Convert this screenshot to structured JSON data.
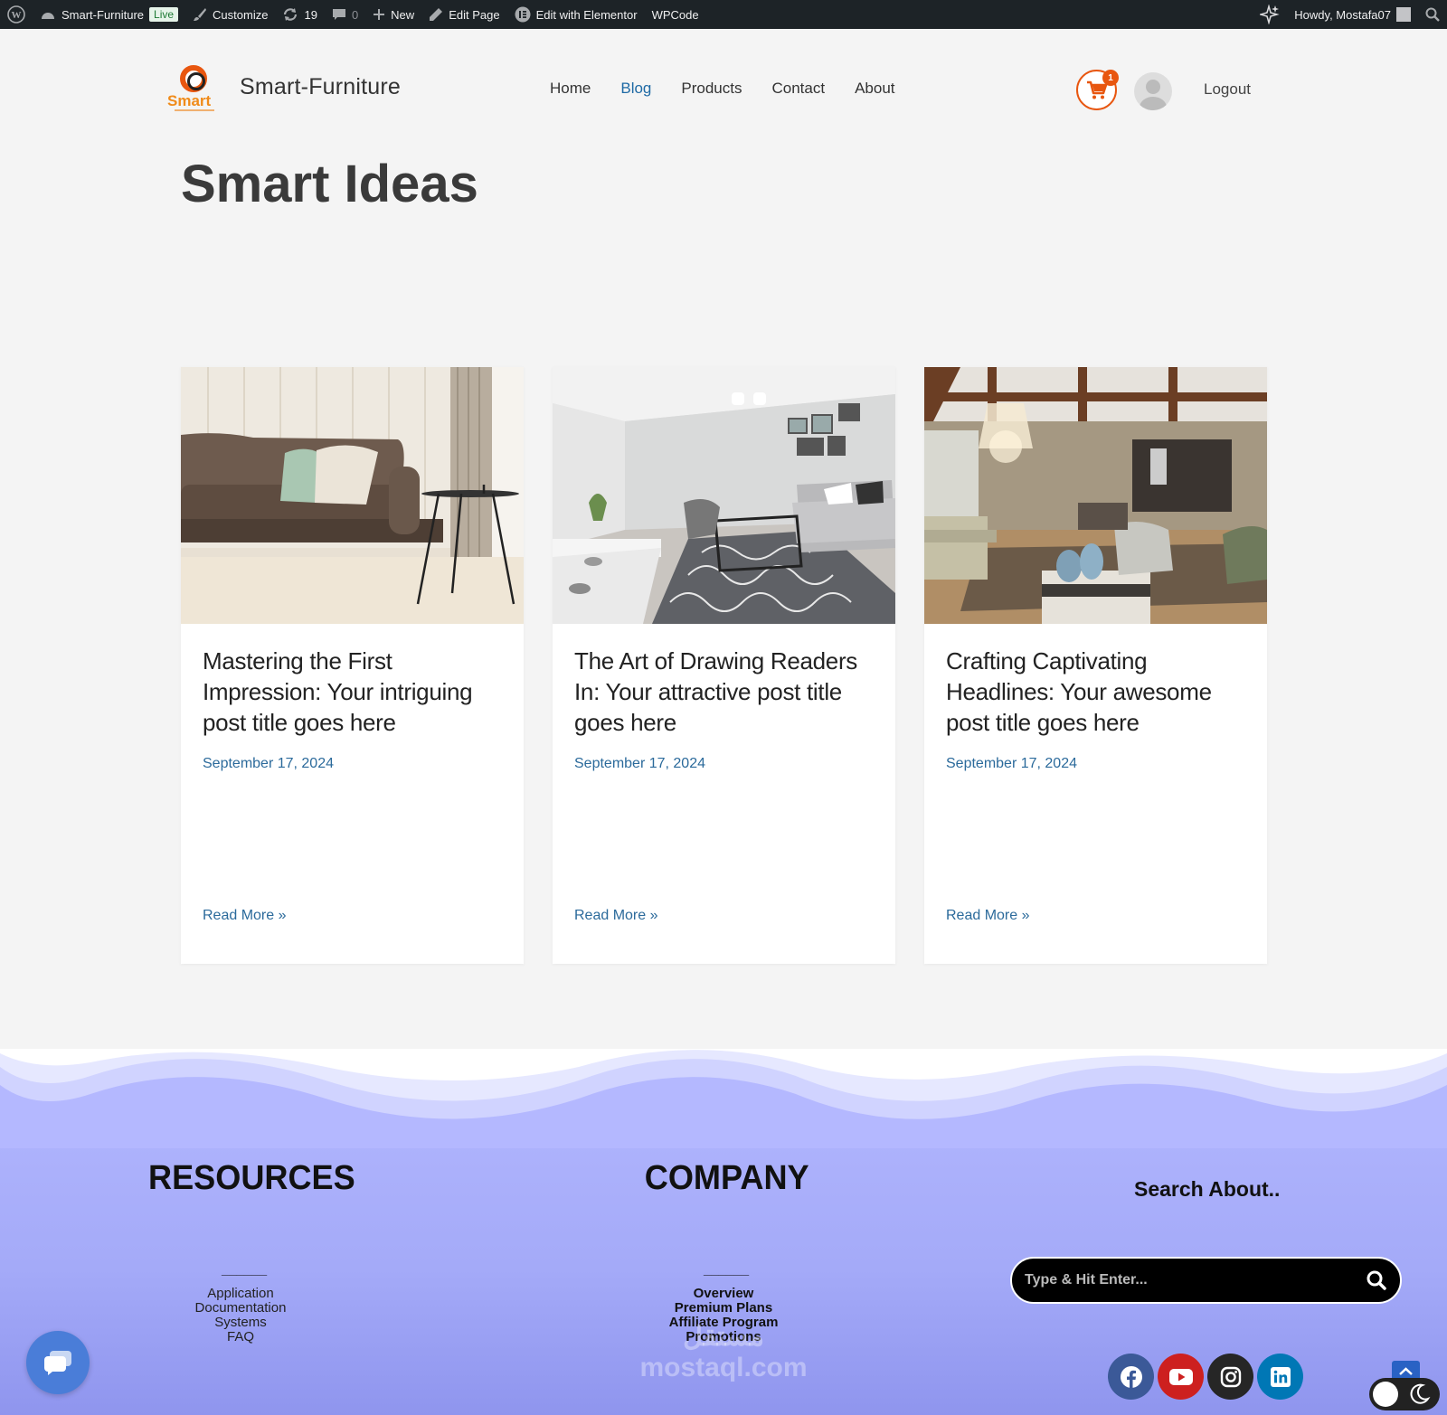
{
  "admin_bar": {
    "site_name": "Smart-Furniture",
    "live_badge": "Live",
    "customize": "Customize",
    "updates_count": "19",
    "comments_count": "0",
    "new": "New",
    "edit_page": "Edit Page",
    "edit_elementor": "Edit with Elementor",
    "wpcode": "WPCode",
    "howdy": "Howdy, Mostafa07"
  },
  "header": {
    "logo_text": "Smart",
    "site_title": "Smart-Furniture",
    "nav": [
      {
        "label": "Home",
        "active": false
      },
      {
        "label": "Blog",
        "active": true
      },
      {
        "label": "Products",
        "active": false
      },
      {
        "label": "Contact",
        "active": false
      },
      {
        "label": "About",
        "active": false
      }
    ],
    "cart_count": "1",
    "logout": "Logout"
  },
  "page": {
    "title": "Smart Ideas"
  },
  "posts": [
    {
      "title": "Mastering the First Impression: Your intriguing post title goes here",
      "date": "September 17, 2024",
      "read_more": "Read More »",
      "image": "living-room-sofa-photo"
    },
    {
      "title": "The Art of Drawing Readers In: Your attractive post title goes here",
      "date": "September 17, 2024",
      "read_more": "Read More »",
      "image": "modern-living-room-photo"
    },
    {
      "title": "Crafting Captivating Headlines: Your awesome post title goes here",
      "date": "September 17, 2024",
      "read_more": "Read More »",
      "image": "open-plan-interior-photo"
    }
  ],
  "footer": {
    "resources": {
      "title": "RESOURCES",
      "separator": "______",
      "links": [
        "Application",
        "Documentation",
        "Systems",
        "FAQ"
      ]
    },
    "company": {
      "title": "COMPANY",
      "separator": "______",
      "links": [
        "Overview",
        "Premium Plans",
        "Affiliate Program",
        "Promotions"
      ]
    },
    "search": {
      "title": "Search About..",
      "placeholder": "Type & Hit Enter..."
    },
    "social": [
      {
        "name": "facebook",
        "color": "#3b5998"
      },
      {
        "name": "youtube",
        "color": "#cd201f"
      },
      {
        "name": "instagram",
        "color": "#262626"
      },
      {
        "name": "linkedin",
        "color": "#0077b5"
      }
    ],
    "watermark_line1": "مستقل",
    "watermark_line2": "mostaql.com"
  },
  "colors": {
    "accent": "#e8560f",
    "link": "#1f6aa5",
    "admin_bar": "#1d2327"
  }
}
